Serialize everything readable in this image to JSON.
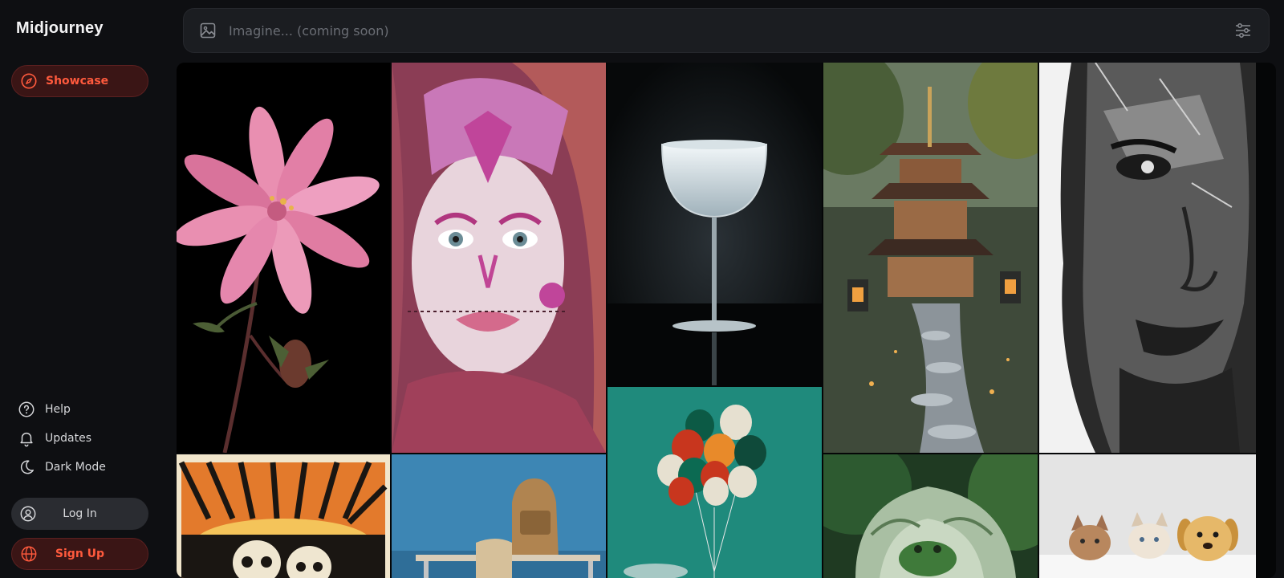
{
  "app": {
    "brand": "Midjourney"
  },
  "sidebar": {
    "showcase_label": "Showcase",
    "help_label": "Help",
    "updates_label": "Updates",
    "dark_mode_label": "Dark Mode",
    "login_label": "Log In",
    "signup_label": "Sign Up"
  },
  "search": {
    "placeholder": "Imagine... (coming soon)"
  },
  "colors": {
    "accent": "#ff5a3d",
    "accent_bg": "#3a1515",
    "background": "#0e0f12"
  },
  "icons": [
    "compass-icon",
    "help-icon",
    "bell-icon",
    "moon-icon",
    "user-icon",
    "globe-icon",
    "image-icon",
    "sliders-icon"
  ],
  "gallery": {
    "tiles": [
      "pink flower on black",
      "woman with pink sugar-skull face paint",
      "cocktail glass on dark background",
      "japanese pagoda with stone path and lanterns",
      "black and white portrait of warrior",
      "woodcut skulls with sunset",
      "backpack on desk against blue wall",
      "balloons against teal sky",
      "frog in cupped hands",
      "kittens and puppy peeking"
    ]
  }
}
